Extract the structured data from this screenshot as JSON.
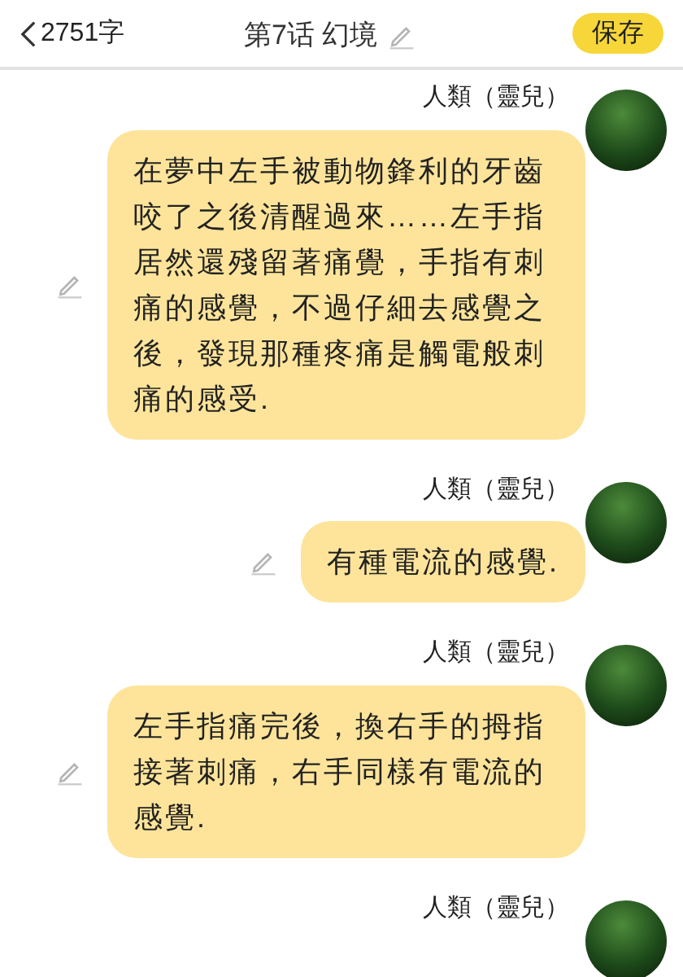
{
  "header": {
    "back_label": "2751字",
    "title": "第7话 幻境",
    "save_button": "保存"
  },
  "messages": [
    {
      "author": "人類（靈兒）",
      "text": "在夢中左手被動物鋒利的牙齒咬了之後清醒過來……左手指居然還殘留著痛覺，手指有刺痛的感覺，不過仔細去感覺之後，發現那種疼痛是觸電般刺痛的感受."
    },
    {
      "author": "人類（靈兒）",
      "text": "有種電流的感覺."
    },
    {
      "author": "人類（靈兒）",
      "text": "左手指痛完後，換右手的拇指接著刺痛，右手同樣有電流的感覺."
    },
    {
      "author": "人類（靈兒）"
    }
  ]
}
